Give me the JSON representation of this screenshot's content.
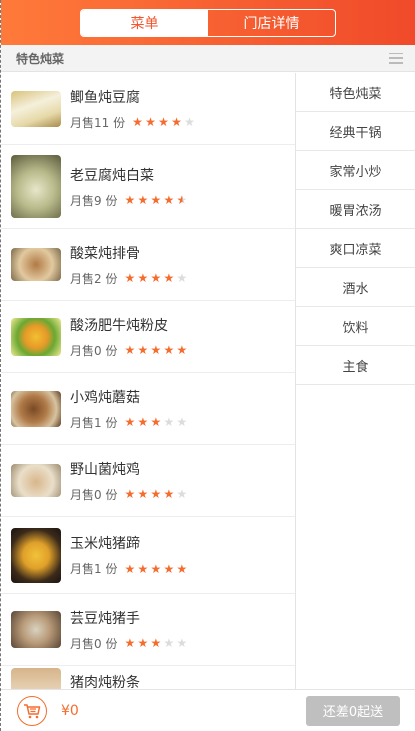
{
  "header": {
    "tabs": [
      {
        "label": "菜单",
        "active": true
      },
      {
        "label": "门店详情",
        "active": false
      }
    ],
    "accent": "#f2562e"
  },
  "category_bar": {
    "title": "特色炖菜",
    "icon": "list-icon"
  },
  "menu": {
    "sales_prefix": "月售",
    "sales_suffix": "份",
    "items": [
      {
        "name": "鲫鱼炖豆腐",
        "sales_text": "月售11 份",
        "sales": 11,
        "rating": 4,
        "image": "fish-tofu-soup"
      },
      {
        "name": "老豆腐炖白菜",
        "sales_text": "月售9 份",
        "sales": 9,
        "rating": 4.5,
        "image": "tofu-cabbage"
      },
      {
        "name": "酸菜炖排骨",
        "sales_text": "月售2 份",
        "sales": 2,
        "rating": 4,
        "image": "sauerkraut-ribs"
      },
      {
        "name": "酸汤肥牛炖粉皮",
        "sales_text": "月售0 份",
        "sales": 0,
        "rating": 5,
        "image": "sour-soup-beef"
      },
      {
        "name": "小鸡炖蘑菇",
        "sales_text": "月售1 份",
        "sales": 1,
        "rating": 3,
        "image": "chicken-mushroom"
      },
      {
        "name": "野山菌炖鸡",
        "sales_text": "月售0 份",
        "sales": 0,
        "rating": 4,
        "image": "wild-mushroom-chicken"
      },
      {
        "name": "玉米炖猪蹄",
        "sales_text": "月售1 份",
        "sales": 1,
        "rating": 5,
        "image": "corn-pork-trotter"
      },
      {
        "name": "芸豆炖猪手",
        "sales_text": "月售0 份",
        "sales": 0,
        "rating": 3,
        "image": "bean-pork-hand"
      },
      {
        "name": "猪肉炖粉条",
        "sales_text": "",
        "sales": null,
        "rating": null,
        "image": "pork-noodles"
      }
    ]
  },
  "side_nav": {
    "items": [
      "特色炖菜",
      "经典干锅",
      "家常小炒",
      "暖胃浓汤",
      "爽口凉菜",
      "酒水",
      "饮料",
      "主食"
    ]
  },
  "footer": {
    "cart_icon": "cart-icon",
    "total": "¥0",
    "checkout_label": "还差0起送"
  }
}
